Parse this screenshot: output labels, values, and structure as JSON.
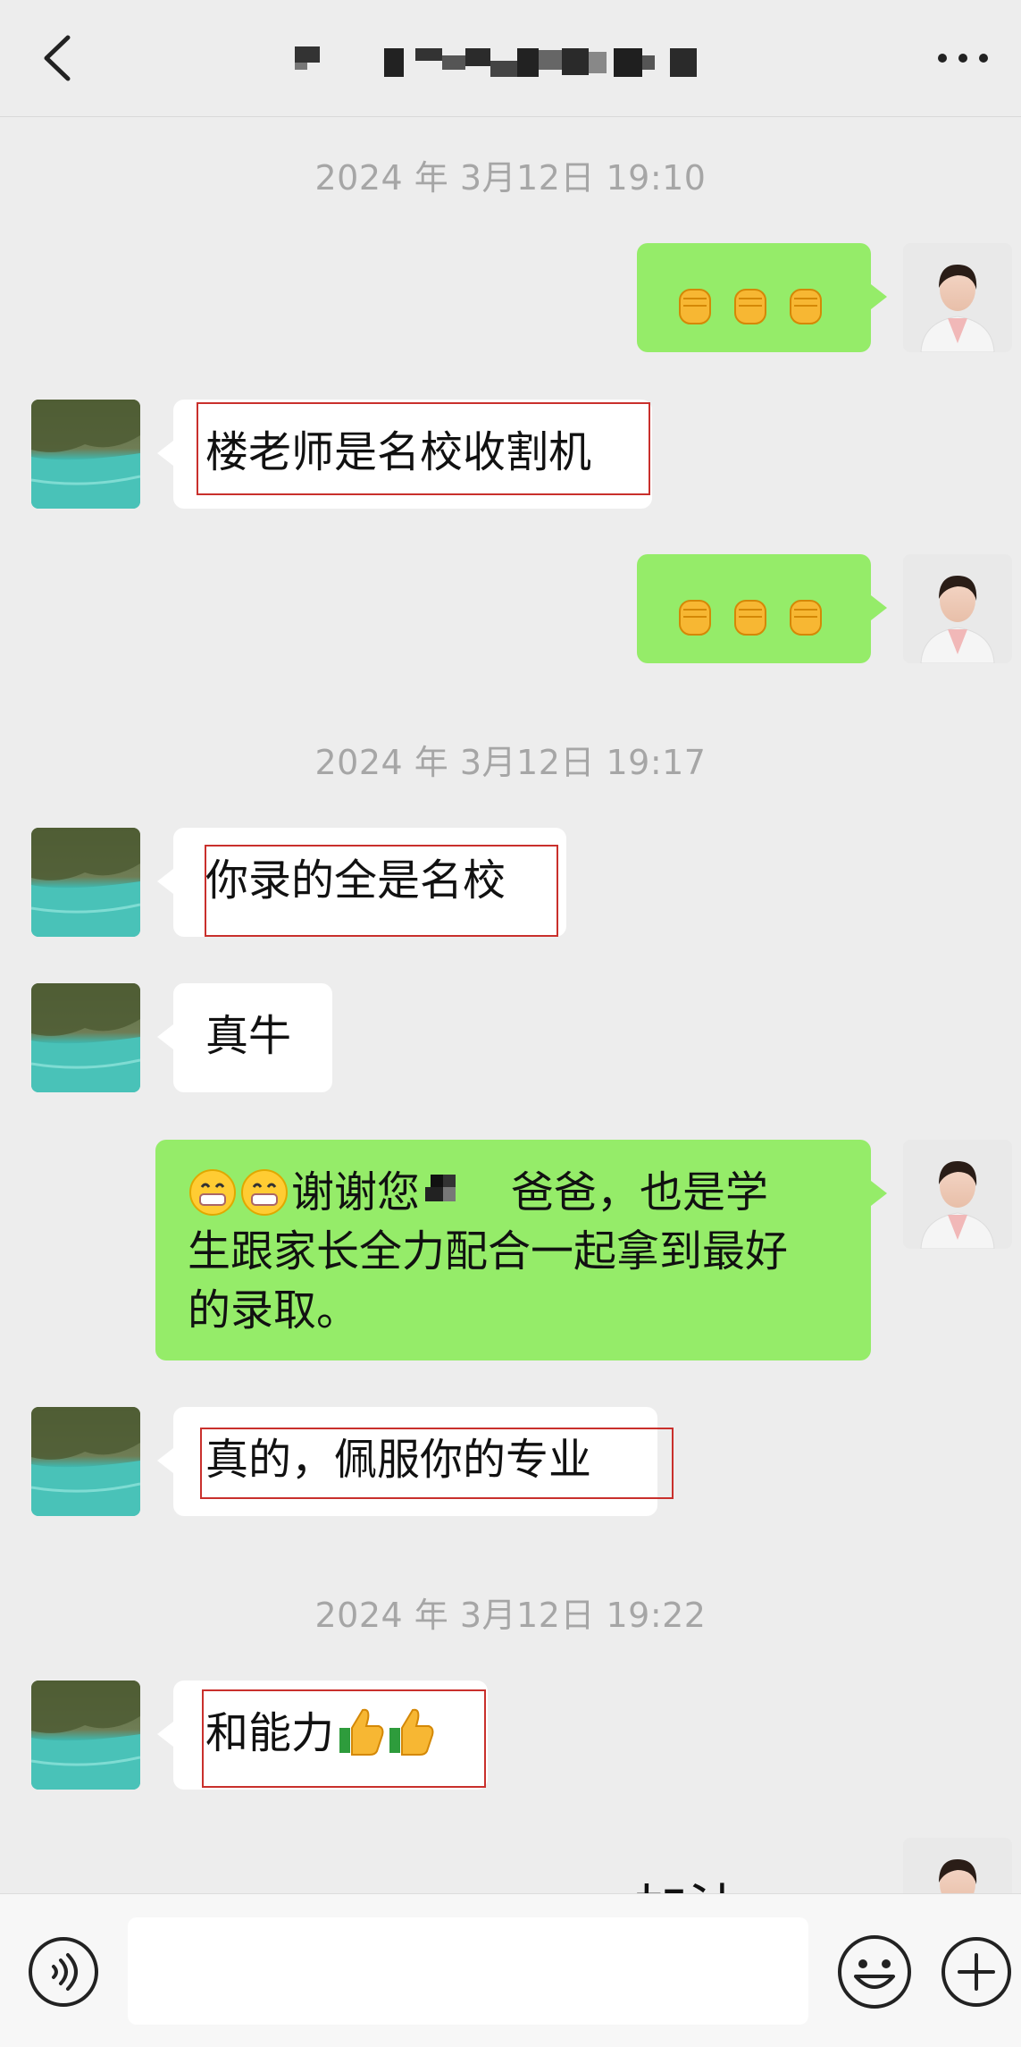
{
  "header": {
    "title": "",
    "back_icon": "chevron-left-icon",
    "more_icon": "more-dots-icon"
  },
  "timestamps": [
    "2024 年 3月12日 19:10",
    "2024 年 3月12日 19:17",
    "2024 年 3月12日 19:22"
  ],
  "messages": [
    {
      "side": "right",
      "text": "",
      "emoji": "✊✊✊"
    },
    {
      "side": "left",
      "text": "楼老师是名校收割机"
    },
    {
      "side": "right",
      "text": "",
      "emoji": "✊✊✊"
    },
    {
      "side": "left",
      "text": "你录的全是名校"
    },
    {
      "side": "left",
      "text": "真牛"
    },
    {
      "side": "right",
      "lines": [
        "谢谢您",
        "爸爸，也是学",
        "生跟家长全力配合一起拿到最好",
        "的录取。"
      ],
      "emoji": "😁😁"
    },
    {
      "side": "left",
      "text": "真的，佩服你的专业"
    },
    {
      "side": "left",
      "text": "和能力",
      "emoji": "👍👍"
    },
    {
      "side": "right",
      "text": "加油"
    }
  ],
  "input_bar": {
    "placeholder": "",
    "voice_icon": "voice-icon",
    "emoji_icon": "emoji-face-icon",
    "plus_icon": "plus-icon"
  },
  "colors": {
    "background": "#ededed",
    "sent_bubble": "#95ec69",
    "received_bubble": "#ffffff",
    "timestamp": "#a6a6a6",
    "highlight_box": "#c9302c"
  }
}
